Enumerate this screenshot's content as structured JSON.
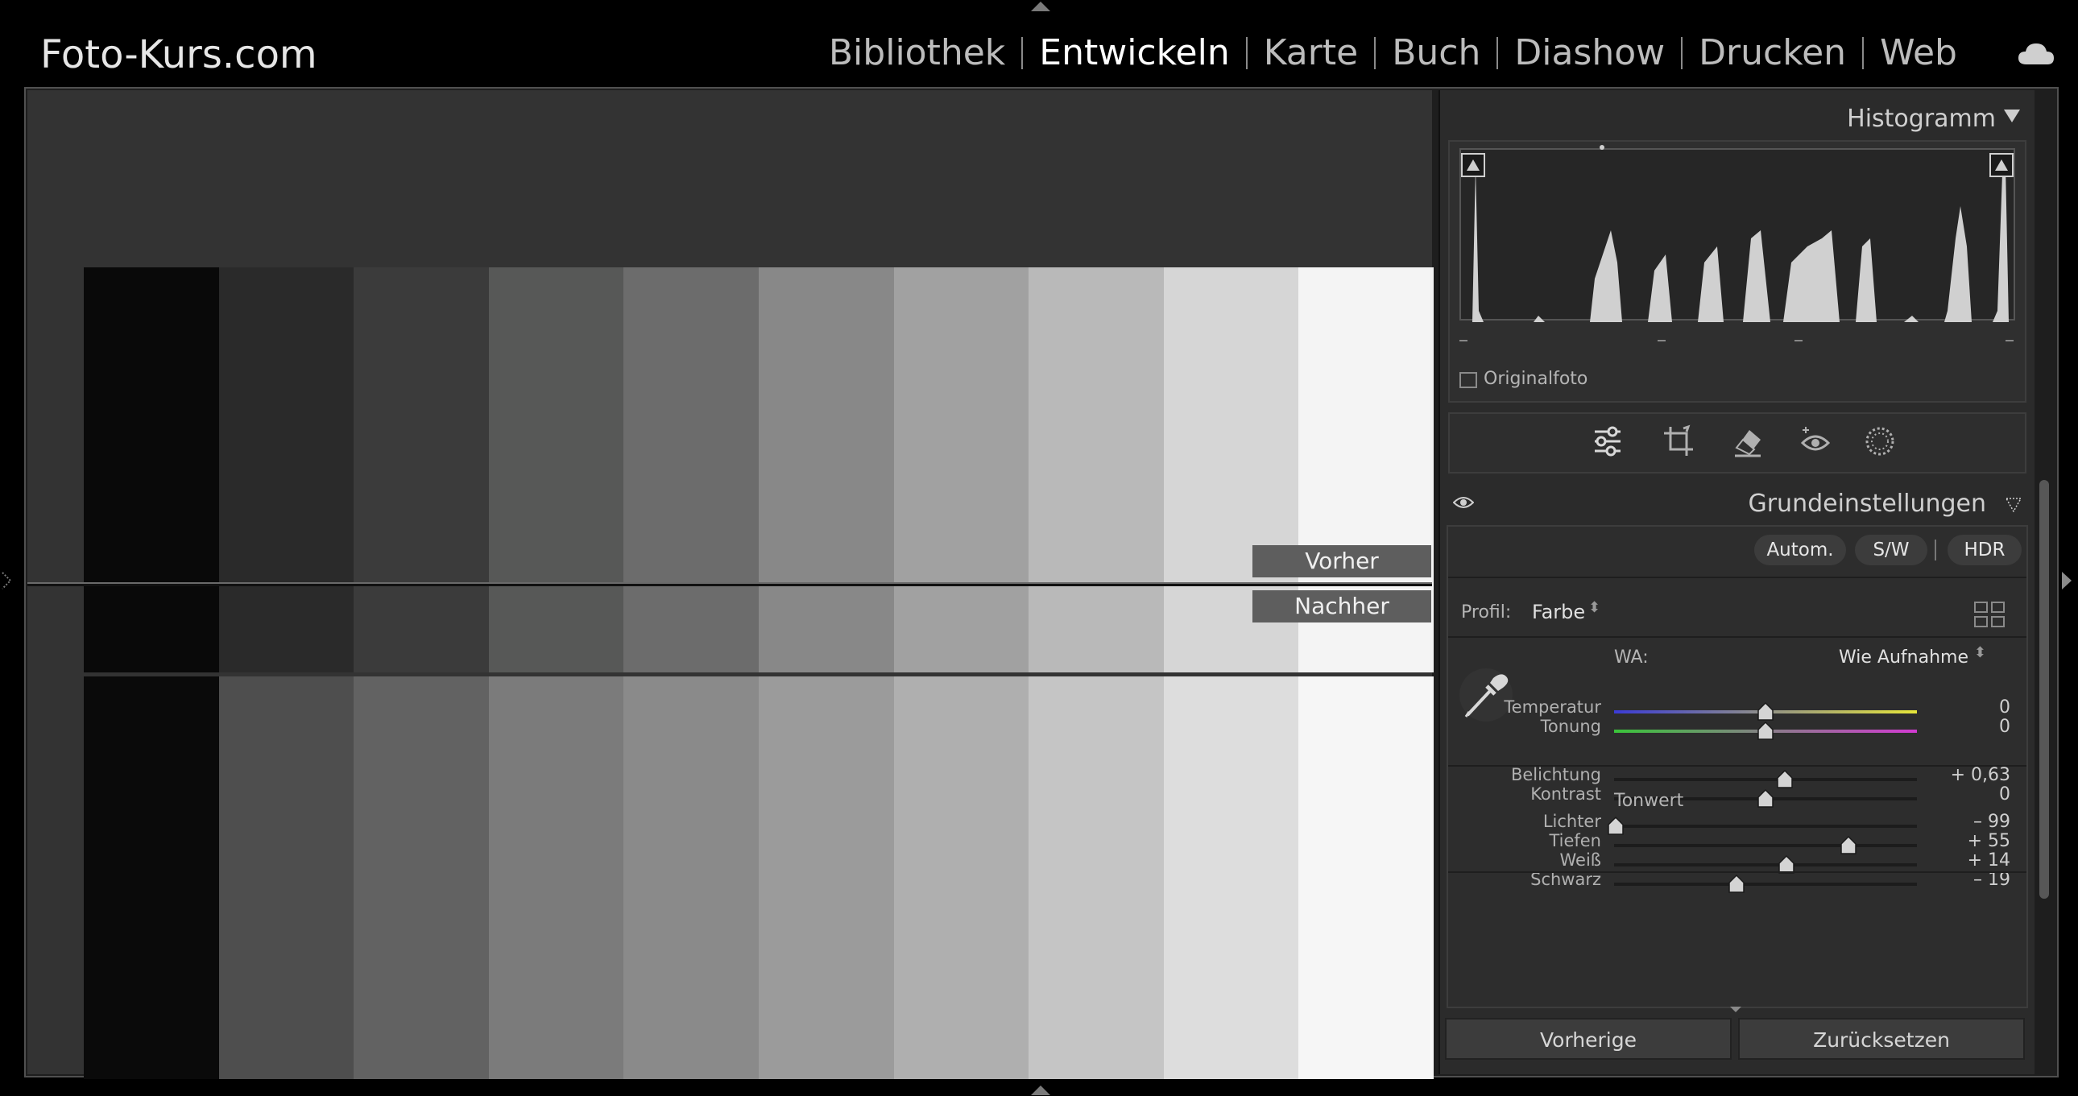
{
  "app": {
    "title": "Foto-Kurs.com"
  },
  "modules": [
    {
      "label": "Bibliothek",
      "active": false
    },
    {
      "label": "Entwickeln",
      "active": true
    },
    {
      "label": "Karte",
      "active": false
    },
    {
      "label": "Buch",
      "active": false
    },
    {
      "label": "Diashow",
      "active": false
    },
    {
      "label": "Drucken",
      "active": false
    },
    {
      "label": "Web",
      "active": false
    }
  ],
  "cloud_icon": "cloud-icon",
  "preview": {
    "before_label": "Vorher",
    "after_label": "Nachher",
    "before_patches": [
      "#090909",
      "#2a2a2a",
      "#3b3b3b",
      "#575857",
      "#6c6c6c",
      "#888888",
      "#a1a1a1",
      "#b9b9b9",
      "#d6d6d6",
      "#f4f4f4"
    ],
    "after_patches": [
      "#0a0a0a",
      "#4e4e4e",
      "#626262",
      "#7b7b7b",
      "#8a8a8a",
      "#9b9b9b",
      "#afafaf",
      "#c5c5c5",
      "#dddddd",
      "#f6f6f6"
    ]
  },
  "histogram": {
    "title": "Histogramm",
    "original_photo_label": "Originalfoto",
    "original_photo_checked": false
  },
  "tools": [
    "sliders-icon",
    "crop-icon",
    "eraser-icon",
    "red-eye-icon",
    "mask-icon"
  ],
  "basic": {
    "title": "Grundeinstellungen",
    "buttons": {
      "auto": "Autom.",
      "bw": "S/W",
      "hdr": "HDR"
    },
    "profile_label": "Profil:",
    "profile_value": "Farbe",
    "wb_label": "WA:",
    "wb_value": "Wie Aufnahme",
    "tonwert_label": "Tonwert",
    "sliders": [
      {
        "key": "temperatur",
        "label": "Temperatur",
        "value": "0",
        "position": 0.5
      },
      {
        "key": "tonung",
        "label": "Tonung",
        "value": "0",
        "position": 0.5
      },
      {
        "key": "belichtung",
        "label": "Belichtung",
        "value": "+ 0,63",
        "position": 0.563
      },
      {
        "key": "kontrast",
        "label": "Kontrast",
        "value": "0",
        "position": 0.5
      },
      {
        "key": "lichter",
        "label": "Lichter",
        "value": "– 99",
        "position": 0.005
      },
      {
        "key": "tiefen",
        "label": "Tiefen",
        "value": "+ 55",
        "position": 0.775
      },
      {
        "key": "weiss",
        "label": "Weiß",
        "value": "+ 14",
        "position": 0.57
      },
      {
        "key": "schwarz",
        "label": "Schwarz",
        "value": "– 19",
        "position": 0.405
      }
    ]
  },
  "footer": {
    "previous_label": "Vorherige",
    "reset_label": "Zurücksetzen"
  },
  "colors": {
    "temperature_gradient": [
      "#3b3bd6",
      "#e6e63a"
    ],
    "tint_gradient": [
      "#3ac43a",
      "#d23ad2"
    ]
  }
}
